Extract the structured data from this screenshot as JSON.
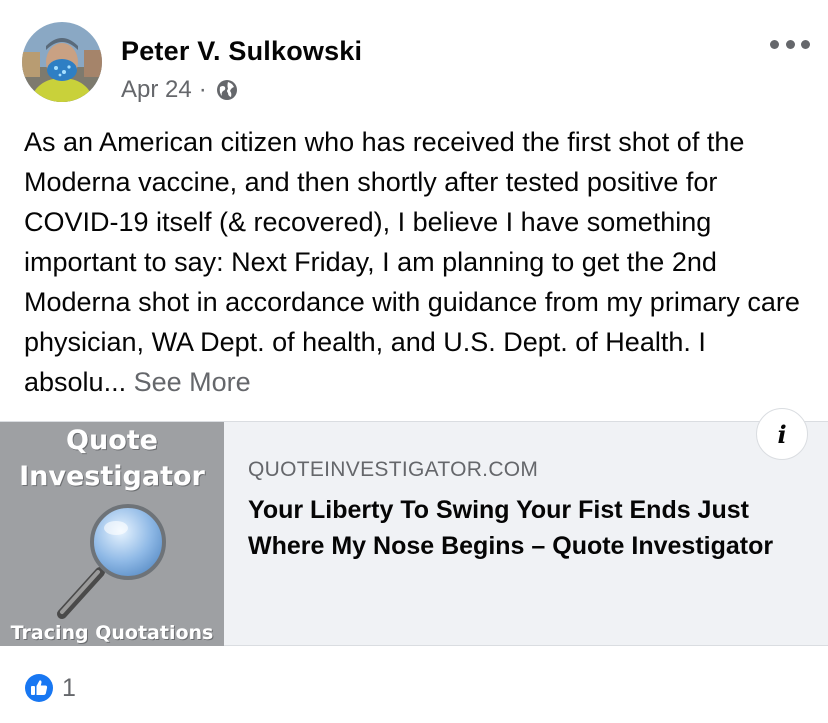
{
  "post": {
    "author": "Peter V. Sulkowski",
    "date": "Apr 24",
    "separator": "·",
    "privacy_icon": "globe-icon",
    "text": "As an American citizen who has received the first shot of the Moderna vaccine, and then shortly after tested positive for COVID-19 itself (& recovered), I believe I have something important to say:   Next Friday, I am planning to get the 2nd Moderna shot in accordance with guidance from my primary care physician, WA Dept. of health, and U.S. Dept. of Health.   I absolu...",
    "see_more": "See More"
  },
  "link_card": {
    "thumbnail": {
      "title_line1": "Quote",
      "title_line2": "Investigator",
      "footer": "Tracing Quotations"
    },
    "domain": "QUOTEINVESTIGATOR.COM",
    "title": "Your Liberty To Swing Your Fist Ends Just Where My Nose Begins – Quote Investigator",
    "info_label": "i"
  },
  "reactions": {
    "icon": "like-icon",
    "count": "1"
  },
  "colors": {
    "secondary_text": "#65676b",
    "like_blue": "#1877f2",
    "card_bg": "#f0f2f5"
  }
}
